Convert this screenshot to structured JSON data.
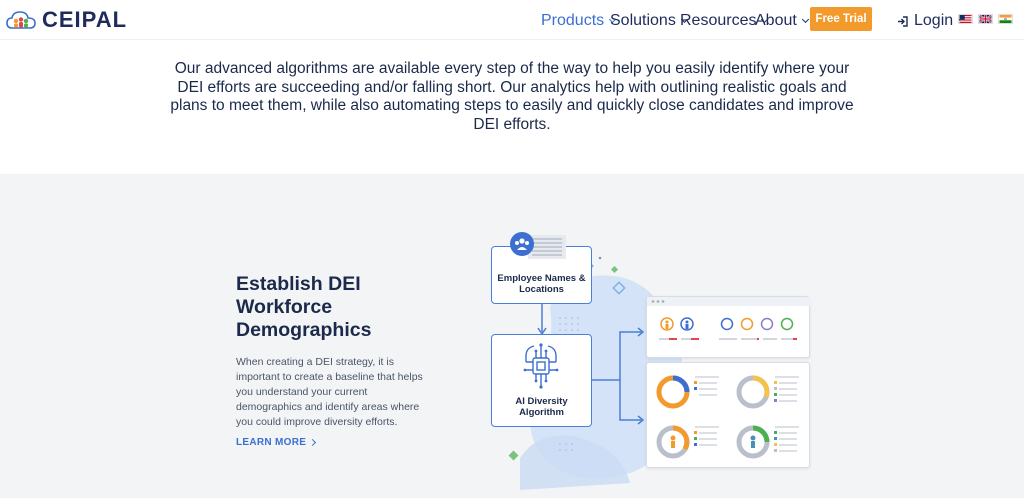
{
  "header": {
    "brand": "CEIPAL",
    "nav": [
      {
        "label": "Products",
        "active": true
      },
      {
        "label": "Solutions",
        "active": false
      },
      {
        "label": "Resources",
        "active": false
      },
      {
        "label": "About",
        "active": false
      }
    ],
    "cta": "Free Trial",
    "login": "Login",
    "flags": [
      "us-flag-icon",
      "uk-flag-icon",
      "india-flag-icon"
    ]
  },
  "intro": {
    "text": "Our advanced algorithms are available every step of the way to help you easily identify where your DEI efforts are succeeding and/or falling short. Our analytics help with outlining realistic goals and plans to meet them, while also automating steps to easily and quickly close candidates and improve DEI efforts."
  },
  "feature": {
    "title": "Establish DEI Workforce Demographics",
    "description": "When creating a DEI strategy, it is important to create a baseline that helps you understand your current demographics and identify areas where you could improve diversity efforts.",
    "link": "LEARN MORE"
  },
  "illustration": {
    "box1": "Employee Names & Locations",
    "box2": "AI Diversity Algorithm",
    "panels": [
      "1. Gender Diversity",
      "2. Ethnic Diversity",
      "3. Female Diversity",
      "4. Male Diversity"
    ]
  },
  "colors": {
    "brand_navy": "#1f2b5b",
    "accent_blue": "#3c6fd1",
    "cta_orange": "#f39a2d",
    "band_grey": "#f3f4f6"
  }
}
